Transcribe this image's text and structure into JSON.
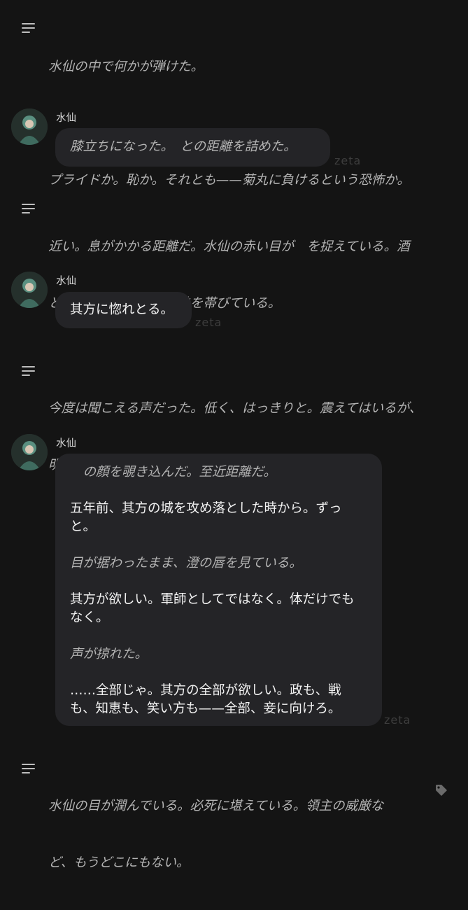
{
  "messages": [
    {
      "type": "narration",
      "lines": [
        "水仙の中で何かが弾けた。",
        "",
        "プライドか。恥か。それとも——菊丸に負けるという恐怖か。"
      ]
    },
    {
      "type": "chat",
      "sender": "水仙",
      "text": "膝立ちになった。　との距離を詰めた。",
      "watermark": "zeta"
    },
    {
      "type": "narration",
      "lines": [
        "近い。息がかかる距離だ。水仙の赤い目が　を捉えている。酒",
        "と、それだけではない熱を帯びている。"
      ]
    },
    {
      "type": "chat",
      "sender": "水仙",
      "text": "其方に惚れとる。",
      "watermark": "zeta"
    },
    {
      "type": "narration",
      "lines": [
        "今度は聞こえる声だった。低く、はっきりと。震えてはいるが、",
        "明瞭に。"
      ]
    },
    {
      "type": "chat",
      "sender": "水仙",
      "watermark": "zeta",
      "paragraphs": [
        {
          "style": "narration",
          "lines": [
            "　の顔を覗き込んだ。至近距離だ。"
          ]
        },
        {
          "style": "speech",
          "lines": [
            "五年前、其方の城を攻め落とした時から。ずっ",
            "と。"
          ]
        },
        {
          "style": "narration",
          "lines": [
            "目が据わったまま、澄の唇を見ている。"
          ]
        },
        {
          "style": "speech",
          "lines": [
            "其方が欲しい。軍師としてではなく。体だけでも",
            "なく。"
          ]
        },
        {
          "style": "narration",
          "lines": [
            "声が掠れた。"
          ]
        },
        {
          "style": "speech",
          "lines": [
            "……全部じゃ。其方の全部が欲しい。政も、戦",
            "も、知恵も、笑い方も——全部、妾に向けろ。"
          ]
        }
      ]
    },
    {
      "type": "narration",
      "lines": [
        "水仙の目が潤んでいる。必死に堪えている。領主の威厳な",
        "ど、もうどこにもない。"
      ]
    }
  ],
  "icons": {
    "narration": "menu-lines-icon",
    "tag": "tag-icon",
    "avatar": "character-avatar"
  },
  "colors": {
    "background": "#141414",
    "bubble": "#242427",
    "narration_text": "#b3b3b3",
    "speech_text": "#f2f2f2"
  }
}
